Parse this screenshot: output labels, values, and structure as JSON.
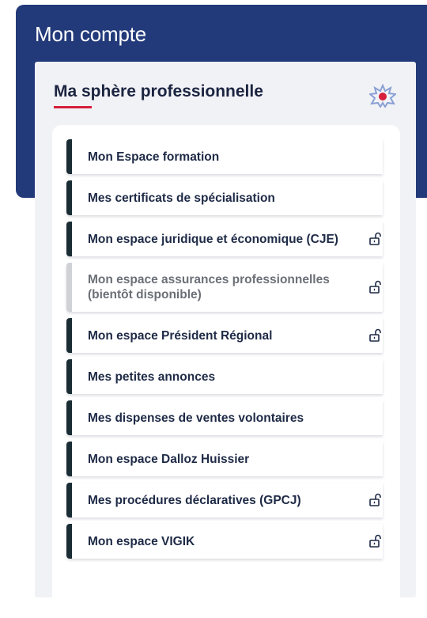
{
  "header": {
    "title": "Mon compte"
  },
  "card": {
    "title": "Ma sphère professionnelle",
    "logo_icon": "star-emblem-icon",
    "accent_color": "#d61f3c"
  },
  "menu": {
    "items": [
      {
        "label": "Mon Espace formation",
        "locked": false,
        "disabled": false
      },
      {
        "label": "Mes certificats de spécialisation",
        "locked": false,
        "disabled": false
      },
      {
        "label": "Mon espace juridique et économique (CJE)",
        "locked": true,
        "disabled": false
      },
      {
        "label": "Mon espace assurances professionnelles (bientôt disponible)",
        "locked": true,
        "disabled": true
      },
      {
        "label": "Mon espace Président Régional",
        "locked": true,
        "disabled": false
      },
      {
        "label": "Mes petites annonces",
        "locked": false,
        "disabled": false
      },
      {
        "label": "Mes dispenses de ventes volontaires",
        "locked": false,
        "disabled": false
      },
      {
        "label": "Mon espace Dalloz Huissier",
        "locked": false,
        "disabled": false
      },
      {
        "label": "Mes procédures déclaratives (GPCJ)",
        "locked": true,
        "disabled": false
      },
      {
        "label": "Mon espace VIGIK",
        "locked": true,
        "disabled": false
      }
    ],
    "lock_icon": "unlocked-padlock-icon"
  },
  "colors": {
    "header_bg": "#233a7a",
    "item_border": "#1a2d35",
    "item_border_disabled": "#d0d2d6",
    "text": "#1e2a46"
  }
}
